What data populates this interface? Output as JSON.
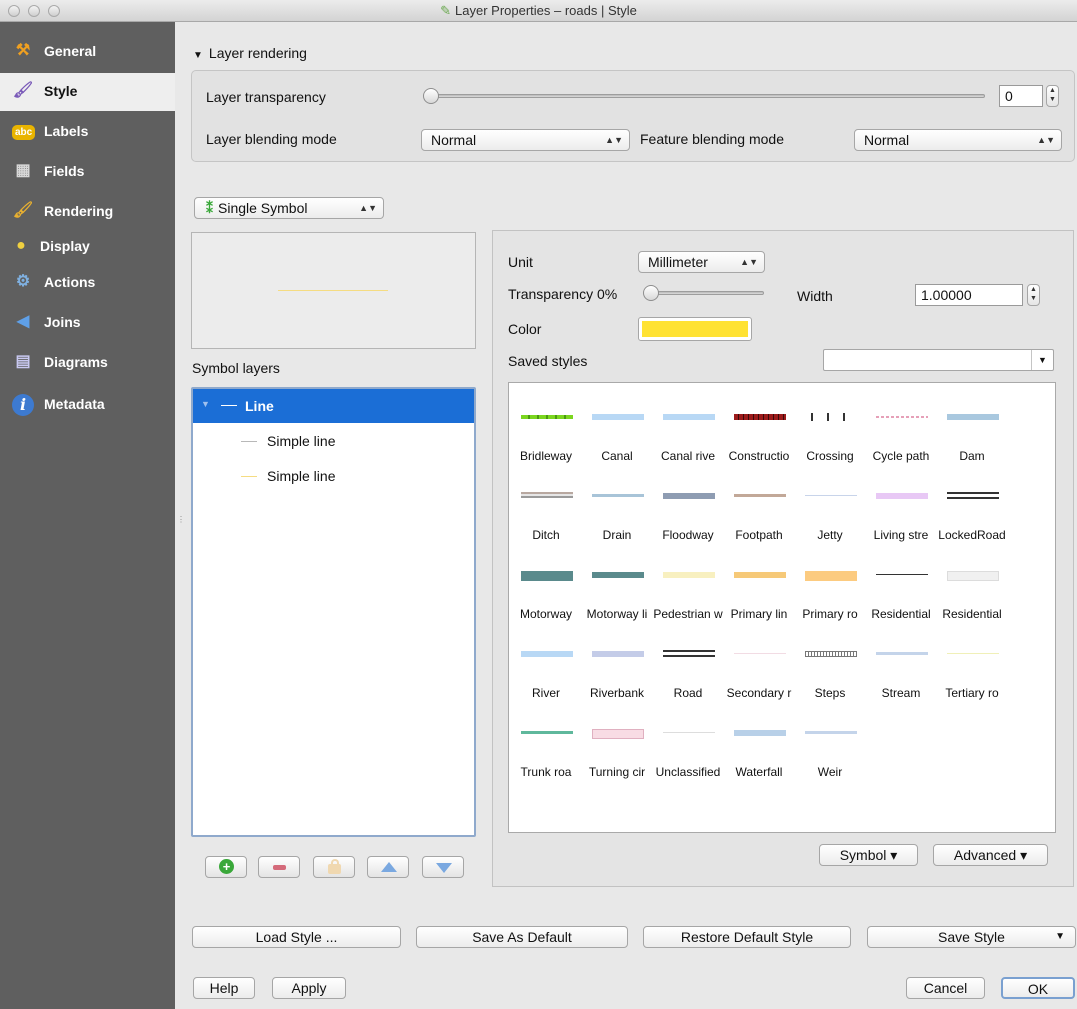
{
  "window": {
    "title": "Layer Properties – roads | Style"
  },
  "sidebar": {
    "items": [
      {
        "label": "General",
        "icon": "tools-icon"
      },
      {
        "label": "Style",
        "icon": "paintbrush-icon"
      },
      {
        "label": "Labels",
        "icon": "abc-label-icon",
        "badge": "abc"
      },
      {
        "label": "Fields",
        "icon": "table-icon"
      },
      {
        "label": "Rendering",
        "icon": "brush-icon"
      },
      {
        "label": "Display",
        "icon": "speech-bubble-icon"
      },
      {
        "label": "Actions",
        "icon": "gear-play-icon"
      },
      {
        "label": "Joins",
        "icon": "join-arrow-icon"
      },
      {
        "label": "Diagrams",
        "icon": "chart-icon"
      },
      {
        "label": "Metadata",
        "icon": "info-icon",
        "badge": "i"
      }
    ],
    "active": "Style"
  },
  "layer_rendering": {
    "title": "Layer rendering",
    "transparency_label": "Layer transparency",
    "transparency_value": "0",
    "layer_blending_label": "Layer blending mode",
    "layer_blending_value": "Normal",
    "feature_blending_label": "Feature blending mode",
    "feature_blending_value": "Normal"
  },
  "renderer": {
    "value": "Single Symbol"
  },
  "symbol_layers": {
    "label": "Symbol layers",
    "rows": [
      "Line",
      "Simple line",
      "Simple line"
    ]
  },
  "symbol": {
    "unit_label": "Unit",
    "unit_value": "Millimeter",
    "transparency_label": "Transparency 0%",
    "width_label": "Width",
    "width_value": "1.00000",
    "color_label": "Color",
    "color_value": "#ffe233",
    "saved_styles_label": "Saved styles",
    "saved_styles_value": ""
  },
  "styles": [
    {
      "name": "Bridleway",
      "color": "#7bd61f",
      "kind": "dashed"
    },
    {
      "name": "Canal",
      "color": "#b8d8f5",
      "kind": "solid"
    },
    {
      "name": "Canal rive",
      "color": "#b8d8f5",
      "kind": "solid"
    },
    {
      "name": "Constructio",
      "color": "#9c1b1b",
      "kind": "dotted"
    },
    {
      "name": "Crossing",
      "color": "#333333",
      "kind": "squares"
    },
    {
      "name": "Cycle path",
      "color": "#e6a0b8",
      "kind": "dotted-thin"
    },
    {
      "name": "Dam",
      "color": "#a9c8df",
      "kind": "solid"
    },
    {
      "name": "Ditch",
      "color": "#9a9a9a",
      "kind": "double-brown"
    },
    {
      "name": "Drain",
      "color": "#a8c4d8",
      "kind": "solid-thin"
    },
    {
      "name": "Floodway",
      "color": "#8e9cb2",
      "kind": "solid"
    },
    {
      "name": "Footpath",
      "color": "#c2a898",
      "kind": "solid-thin"
    },
    {
      "name": "Jetty",
      "color": "#c8d4ea",
      "kind": "hairline"
    },
    {
      "name": "Living stre",
      "color": "#e8c8f5",
      "kind": "solid"
    },
    {
      "name": "LockedRoad",
      "color": "#333333",
      "kind": "double"
    },
    {
      "name": "Motorway",
      "color": "#5a8a8c",
      "kind": "thick"
    },
    {
      "name": "Motorway li",
      "color": "#5a8a8c",
      "kind": "solid"
    },
    {
      "name": "Pedestrian w",
      "color": "#f8f0c0",
      "kind": "solid"
    },
    {
      "name": "Primary lin",
      "color": "#f6c978",
      "kind": "solid"
    },
    {
      "name": "Primary ro",
      "color": "#fccb80",
      "kind": "thick"
    },
    {
      "name": "Residential",
      "color": "#333333",
      "kind": "hairline"
    },
    {
      "name": "Residential",
      "color": "#f0f0f0",
      "kind": "thick-light"
    },
    {
      "name": "River",
      "color": "#b8d8f5",
      "kind": "solid"
    },
    {
      "name": "Riverbank",
      "color": "#c4cce8",
      "kind": "solid"
    },
    {
      "name": "Road",
      "color": "#333333",
      "kind": "double"
    },
    {
      "name": "Secondary r",
      "color": "#f2dce4",
      "kind": "hairline"
    },
    {
      "name": "Steps",
      "color": "#777777",
      "kind": "ticks"
    },
    {
      "name": "Stream",
      "color": "#c4d4ea",
      "kind": "solid-thin"
    },
    {
      "name": "Tertiary ro",
      "color": "#f0f0b8",
      "kind": "hairline"
    },
    {
      "name": "Trunk roa",
      "color": "#5fb89c",
      "kind": "solid-thin"
    },
    {
      "name": "Turning cir",
      "color": "#f8dce4",
      "kind": "box"
    },
    {
      "name": "Unclassified",
      "color": "#dddddd",
      "kind": "hairline"
    },
    {
      "name": "Waterfall",
      "color": "#b8d0e8",
      "kind": "solid"
    },
    {
      "name": "Weir",
      "color": "#c4d4ea",
      "kind": "solid-thin"
    }
  ],
  "panel_buttons": {
    "symbol": "Symbol ▾",
    "advanced": "Advanced ▾"
  },
  "style_buttons": {
    "load": "Load Style ...",
    "save_default": "Save As Default",
    "restore": "Restore Default Style",
    "save": "Save Style"
  },
  "footer": {
    "help": "Help",
    "apply": "Apply",
    "cancel": "Cancel",
    "ok": "OK"
  }
}
